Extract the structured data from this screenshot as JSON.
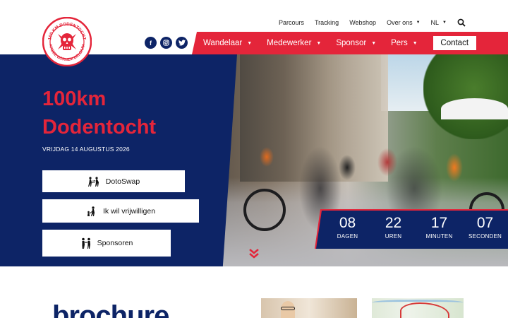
{
  "header": {
    "logo": {
      "alt": "100 KM Dodentocht Kadee Bornem Belgium",
      "text_top": "100 KM DODENTOCHT",
      "text_bottom": "KADEE BORNEM BELGIUM"
    },
    "top_nav": [
      {
        "label": "Parcours",
        "dropdown": false
      },
      {
        "label": "Tracking",
        "dropdown": false
      },
      {
        "label": "Webshop",
        "dropdown": false
      },
      {
        "label": "Over ons",
        "dropdown": true
      },
      {
        "label": "NL",
        "dropdown": true
      }
    ],
    "social": [
      "facebook-icon",
      "instagram-icon",
      "twitter-icon"
    ],
    "main_nav": [
      {
        "label": "Wandelaar",
        "dropdown": true
      },
      {
        "label": "Medewerker",
        "dropdown": true
      },
      {
        "label": "Sponsor",
        "dropdown": true
      },
      {
        "label": "Pers",
        "dropdown": true
      }
    ],
    "contact_label": "Contact"
  },
  "hero": {
    "title_line1": "100km",
    "title_line2": "Dodentocht",
    "date": "VRIJDAG 14 AUGUSTUS 2026",
    "buttons": [
      {
        "label": "DotoSwap",
        "icon": "swap-walkers-icon"
      },
      {
        "label": "Ik wil vrijwilligen",
        "icon": "volunteer-icon"
      },
      {
        "label": "Sponsoren",
        "icon": "handshake-people-icon"
      }
    ]
  },
  "countdown": {
    "days": {
      "value": "08",
      "label": "DAGEN"
    },
    "hours": {
      "value": "22",
      "label": "UREN"
    },
    "minutes": {
      "value": "17",
      "label": "MINUTEN"
    },
    "seconds": {
      "value": "07",
      "label": "SECONDEN"
    }
  },
  "below": {
    "brochure_title": "brochure"
  },
  "colors": {
    "navy": "#0d2466",
    "red": "#e4253a",
    "white": "#ffffff"
  }
}
